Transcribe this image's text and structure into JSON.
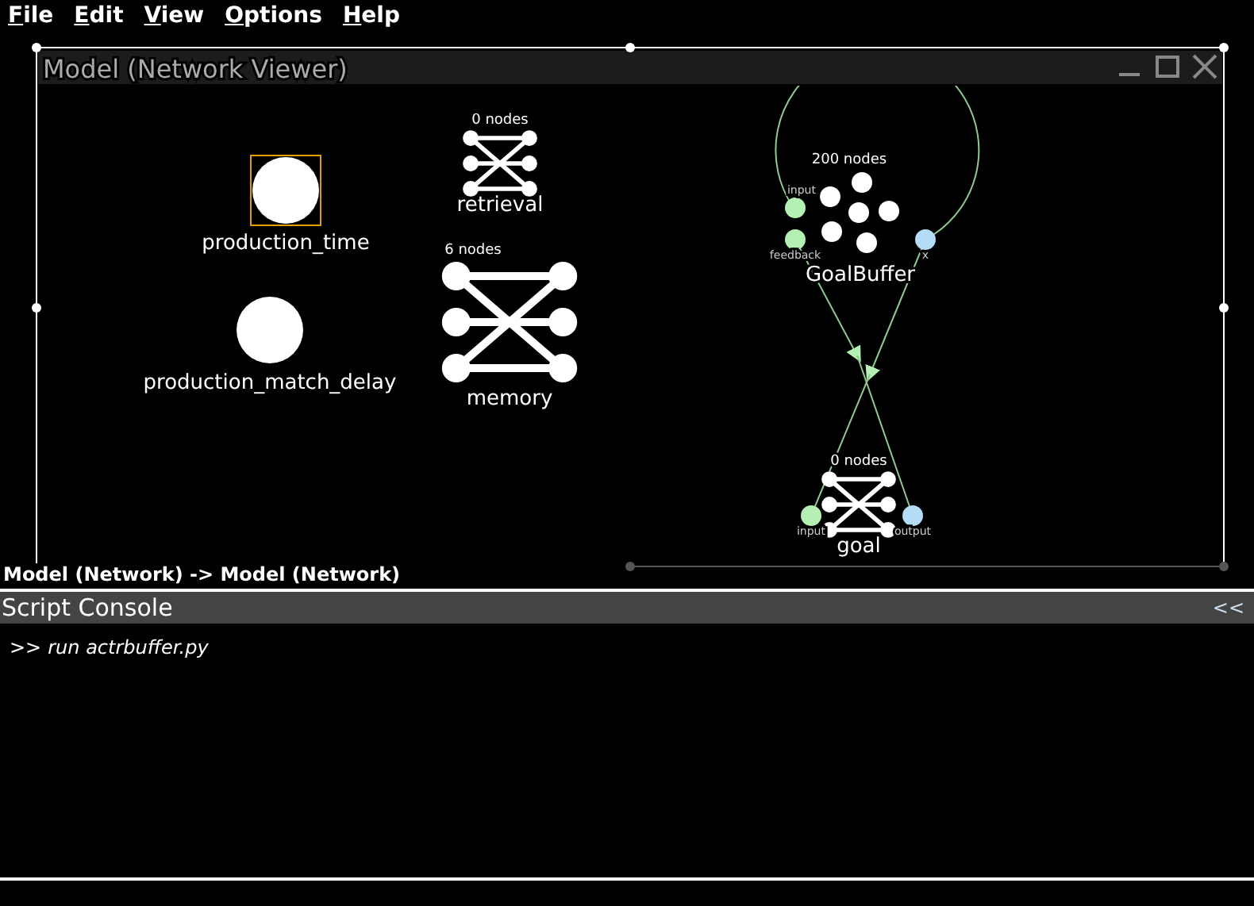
{
  "menu": [
    {
      "label": "File"
    },
    {
      "label": "Edit"
    },
    {
      "label": "View"
    },
    {
      "label": "Options"
    },
    {
      "label": "Help"
    }
  ],
  "window": {
    "title": "Model (Network Viewer)"
  },
  "nodes": [
    {
      "kind": "ensemble",
      "label": "production_time",
      "selected": true
    },
    {
      "kind": "ensemble",
      "label": "production_match_delay",
      "selected": false
    },
    {
      "kind": "network",
      "label": "retrieval",
      "count": "0 nodes",
      "selected": false
    },
    {
      "kind": "network",
      "label": "memory",
      "count": "6 nodes",
      "selected": false
    },
    {
      "kind": "buffer",
      "label": "GoalBuffer",
      "count": "200 nodes",
      "selected": false,
      "ports": [
        {
          "label": "input",
          "color": "#b4f0b4"
        },
        {
          "label": "feedback",
          "color": "#b4f0b4"
        },
        {
          "label": "x",
          "color": "#b4dcf5"
        }
      ]
    },
    {
      "kind": "network",
      "label": "goal",
      "count": "0 nodes",
      "selected": false,
      "ports": [
        {
          "label": "input",
          "color": "#b4f0b4"
        },
        {
          "label": "output",
          "color": "#b4dcf5"
        }
      ]
    }
  ],
  "breadcrumb": "Model (Network) -> Model (Network)",
  "console": {
    "title": "Script Console",
    "collapse": "<<",
    "lines": [
      {
        "prompt": ">>",
        "command": "run actrbuffer.py"
      }
    ]
  }
}
